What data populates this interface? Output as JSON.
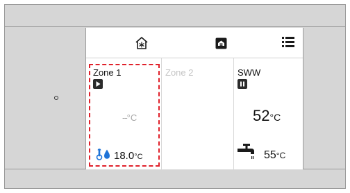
{
  "side_panel": {
    "button": "power-button"
  },
  "topbar": {
    "icons": [
      "house-snowflake-icon",
      "settings-card-icon",
      "menu-list-icon"
    ]
  },
  "zone1": {
    "title": "Zone 1",
    "mode_icon": "play-icon",
    "setpoint_value": "--",
    "setpoint_unit": "°C",
    "measured_value": "18.0",
    "measured_unit": "°C",
    "selected": true,
    "highlight_color": "#e0202a"
  },
  "zone2": {
    "title": "Zone 2",
    "enabled": false
  },
  "sww": {
    "title": "SWW",
    "mode_icon": "pause-icon",
    "setpoint_value": "52",
    "setpoint_unit": "°C",
    "tank_value": "55",
    "tank_unit": "°C",
    "tank_icon": "faucet-icon"
  }
}
